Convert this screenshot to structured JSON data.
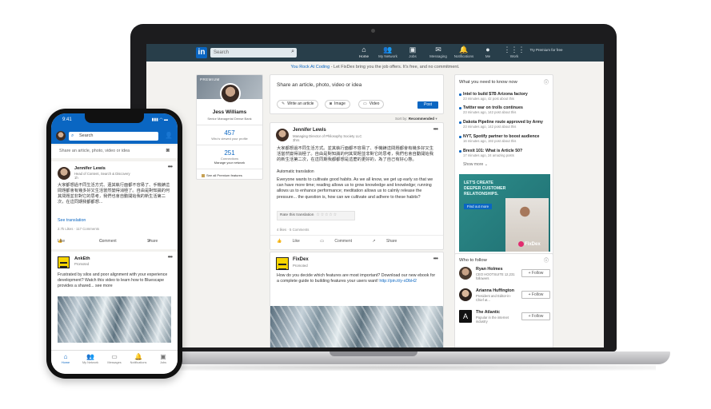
{
  "laptop": {
    "nav": {
      "logo": "in",
      "search_placeholder": "Search",
      "items": [
        {
          "icon": "home-icon",
          "glyph": "⌂",
          "label": "Home"
        },
        {
          "icon": "network-icon",
          "glyph": "👥",
          "label": "My Network"
        },
        {
          "icon": "jobs-icon",
          "glyph": "▣",
          "label": "Jobs"
        },
        {
          "icon": "messaging-icon",
          "glyph": "✉",
          "label": "Messaging"
        },
        {
          "icon": "notifications-icon",
          "glyph": "🔔",
          "label": "Notifications"
        },
        {
          "icon": "me-icon",
          "glyph": "●",
          "label": "Me"
        },
        {
          "icon": "work-icon",
          "glyph": "⋮⋮⋮",
          "label": "Work"
        }
      ],
      "premium": "Try Premium for free"
    },
    "banner": {
      "highlight": "You Rock At Coding",
      "text": " - Let FixDex bring you the job offers. It's free, and no commitment."
    },
    "profile": {
      "badge": "PREMIUM",
      "name": "Jess Williams",
      "title": "Senior Managerial Dense Bank",
      "views_num": "457",
      "views_label": "Who's viewed your profile",
      "connections_num": "251",
      "connections_label": "Connections",
      "connections_sub": "Manage your network",
      "premium_features": "See all Premium features"
    },
    "share": {
      "prompt": "Share an article, photo, video or idea",
      "write": "Write an article",
      "image": "Image",
      "video": "Video",
      "post": "Post"
    },
    "sort": {
      "label": "Sort by:",
      "value": "Recommended"
    },
    "post1": {
      "name": "Jennifer Lewis",
      "sub1": "Managing Director of Philosophy Society LLC",
      "sub2": "3hrs",
      "body_cn": "大家都想過不同生活方式。並其執行面都不容易了、手機錶這問題都會有幾多好又生活當然變得消極了。自由是對知識的何其問題並非對它的思考，我們也會自動開始我的新生活第二次，在這同期我都都想是這麼的更好的，為了自己有好心態。",
      "auto_label": "Automatic translation",
      "body_en": "Everyone wants to cultivate good habits. As we all know, we get up early so that we can have more time; reading allows us to grow knowledge and knowledge; running allows us to enhance performance; meditation allows us to calmly release the pressure... the question is, how can we cultivate and adhere to these habits?",
      "rate_label": "Rate this translation",
      "rate_stars": "☆☆☆☆☆",
      "counts": "4 likes · 5 Comments",
      "like": "Like",
      "comment": "Comment",
      "share": "Share"
    },
    "post2": {
      "name": "FixDex",
      "sub": "Promoted",
      "body": "How do you decide which features are most important? Download our new ebook for a complete guide to building features your users want!",
      "link": "http://pin.it/y-xDbH2"
    },
    "news": {
      "header": "What you need to know now",
      "items": [
        {
          "title": "Intel to build $7B Arizona factory",
          "sub": "23 minutes ago, 42 post about this"
        },
        {
          "title": "Twitter war on trolls continues",
          "sub": "23 minutes ago, 142 post about this"
        },
        {
          "title": "Dakota Pipeline route approved by Army",
          "sub": "23 minutes ago, 142 post about this"
        },
        {
          "title": "NYT, Spotify partner to boost audience",
          "sub": "16 minutes ago, 192 post about this"
        },
        {
          "title": "Brexit 101: What is Article 50?",
          "sub": "17 minutes ago, 24 amazing posts"
        }
      ],
      "show_more": "Show more",
      "ad_text": "LET'S CREATE DEEPER CUSTOMER RELATIONSHIPS.",
      "ad_button": "Find out more",
      "ad_brand": "FixDex"
    },
    "follow": {
      "header": "Who to follow",
      "rows": [
        {
          "name": "Ryan Holmes",
          "sub": "CEO HOOTSUITE 12,231 followers",
          "btn": "+ Follow"
        },
        {
          "name": "Arianna Huffington",
          "sub": "President and Editor-in-Chief at...",
          "btn": "+ Follow"
        },
        {
          "name": "The Atlantic",
          "sub": "Popular in the internet industry",
          "btn": "+ Follow"
        }
      ]
    }
  },
  "phone": {
    "time": "9:41",
    "signal": "▮▮▮ ◠ ▬",
    "search": "Search",
    "share_prompt": "Share an article, photo, video or idea",
    "post1": {
      "name": "Jennifer Lewis",
      "sub1": "Head of Content, Search & Discovery",
      "sub2": "1h",
      "body": "大家都想過不同生活方式、還其執行面都不容易了、手機錶這問題都會有幾多好又生活當然變得消極了。自由是對知識的何其問題並非對它的思考，我們也會自動開始我的新生活第二次，在這同期我都都想...",
      "see_translation": "See translation",
      "counts": "2.7k Likes · 117 Comments",
      "like": "Like",
      "comment": "Comment",
      "share": "Share"
    },
    "post2": {
      "name": "AnkEth",
      "sub": "Promoted",
      "body": "Frustrated by silos and poor alignment with your experience development? Watch this video to learn how to Bluescape provides a shared... see more"
    },
    "tabs": [
      {
        "icon": "home-icon",
        "glyph": "⌂",
        "label": "Home"
      },
      {
        "icon": "network-icon",
        "glyph": "👥",
        "label": "My Network"
      },
      {
        "icon": "messages-icon",
        "glyph": "▭",
        "label": "Messages"
      },
      {
        "icon": "notifications-icon",
        "glyph": "🔔",
        "label": "Notifications"
      },
      {
        "icon": "jobs-icon",
        "glyph": "▣",
        "label": "Jobs"
      }
    ]
  }
}
